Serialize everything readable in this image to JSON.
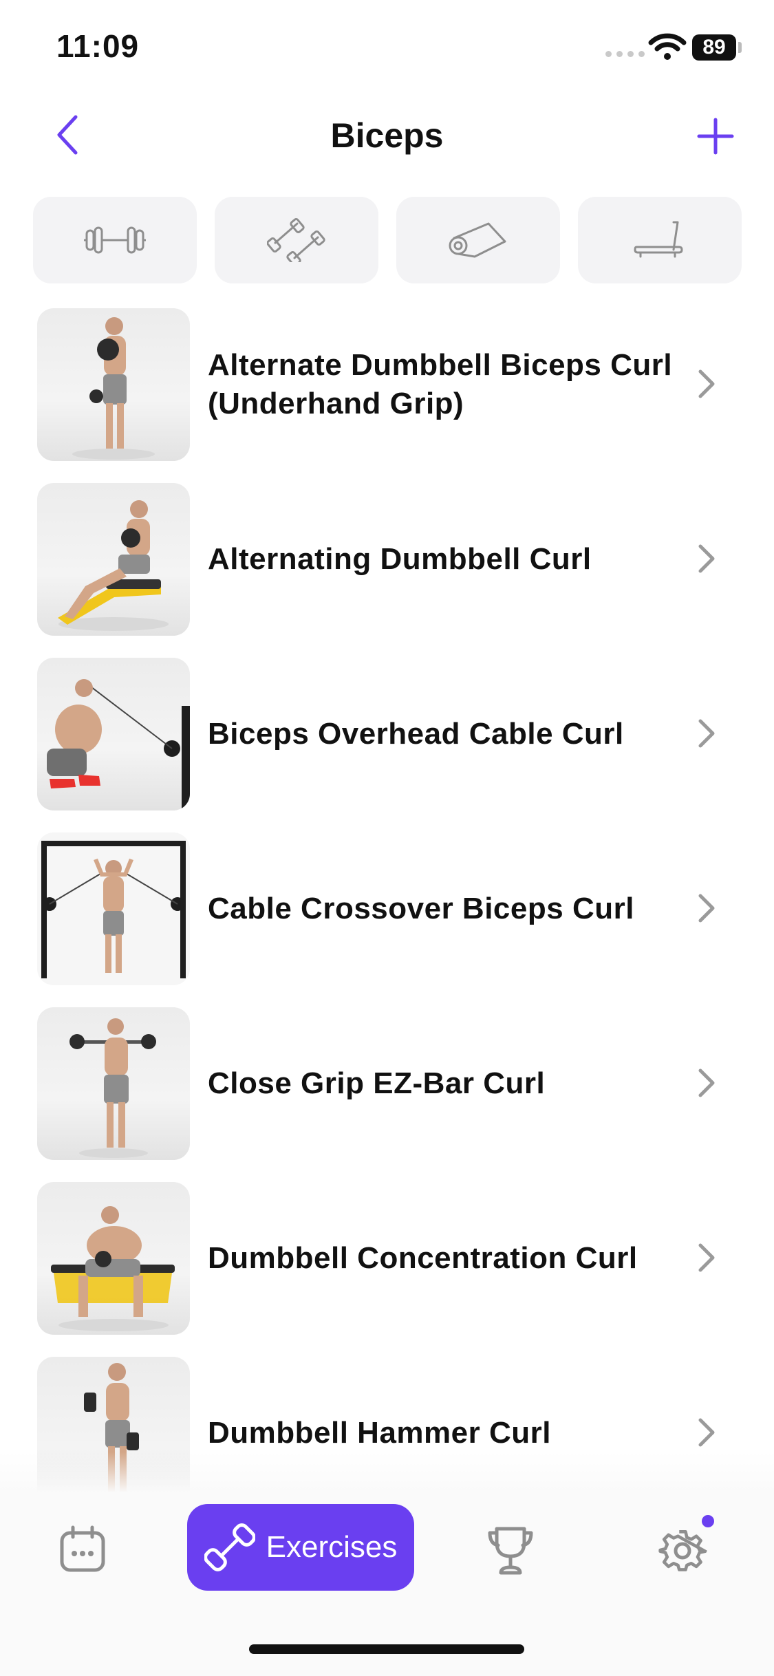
{
  "status": {
    "time": "11:09",
    "battery": "89"
  },
  "nav": {
    "title": "Biceps",
    "back_icon": "chevron-left-icon",
    "add_icon": "plus-icon"
  },
  "filters": [
    {
      "icon": "barbell-icon"
    },
    {
      "icon": "dumbbells-icon"
    },
    {
      "icon": "mat-icon"
    },
    {
      "icon": "treadmill-icon"
    }
  ],
  "exercises": [
    {
      "name": "Alternate Dumbbell Biceps Curl (Underhand Grip)"
    },
    {
      "name": "Alternating Dumbbell Curl"
    },
    {
      "name": "Biceps Overhead Cable Curl"
    },
    {
      "name": "Cable Crossover Biceps Curl"
    },
    {
      "name": "Close Grip EZ-Bar Curl"
    },
    {
      "name": "Dumbbell Concentration Curl"
    },
    {
      "name": "Dumbbell Hammer Curl"
    }
  ],
  "tab_bar": {
    "calendar_icon": "calendar-icon",
    "exercises_label": "Exercises",
    "trophy_icon": "trophy-icon",
    "settings_icon": "gear-icon"
  },
  "colors": {
    "accent": "#6a3ff0",
    "filter_bg": "#f3f3f5",
    "icon_gray": "#9a9a9a"
  }
}
